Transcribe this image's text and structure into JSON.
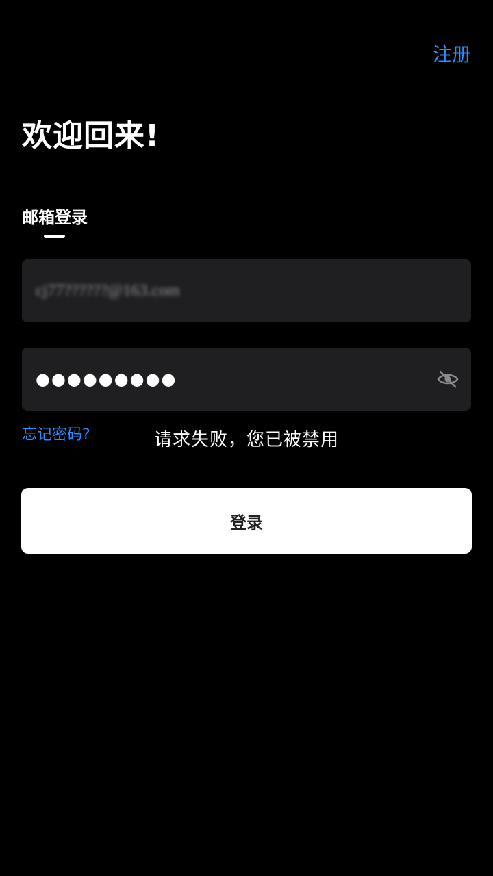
{
  "header": {
    "register_label": "注册"
  },
  "main": {
    "title": "欢迎回来!",
    "tabs": [
      {
        "label": "邮箱登录",
        "active": true
      }
    ],
    "email_field": {
      "value": "cj77??????@163.com"
    },
    "password_field": {
      "value": "●●●●●●●●●",
      "toggle_icon": "eye-off-icon"
    },
    "forgot_label": "忘记密码?",
    "toast_message": "请求失败，您已被禁用",
    "login_label": "登录"
  },
  "colors": {
    "background": "#000000",
    "link": "#2f8cff",
    "field_bg": "#1f1f21",
    "button_bg": "#ffffff"
  }
}
